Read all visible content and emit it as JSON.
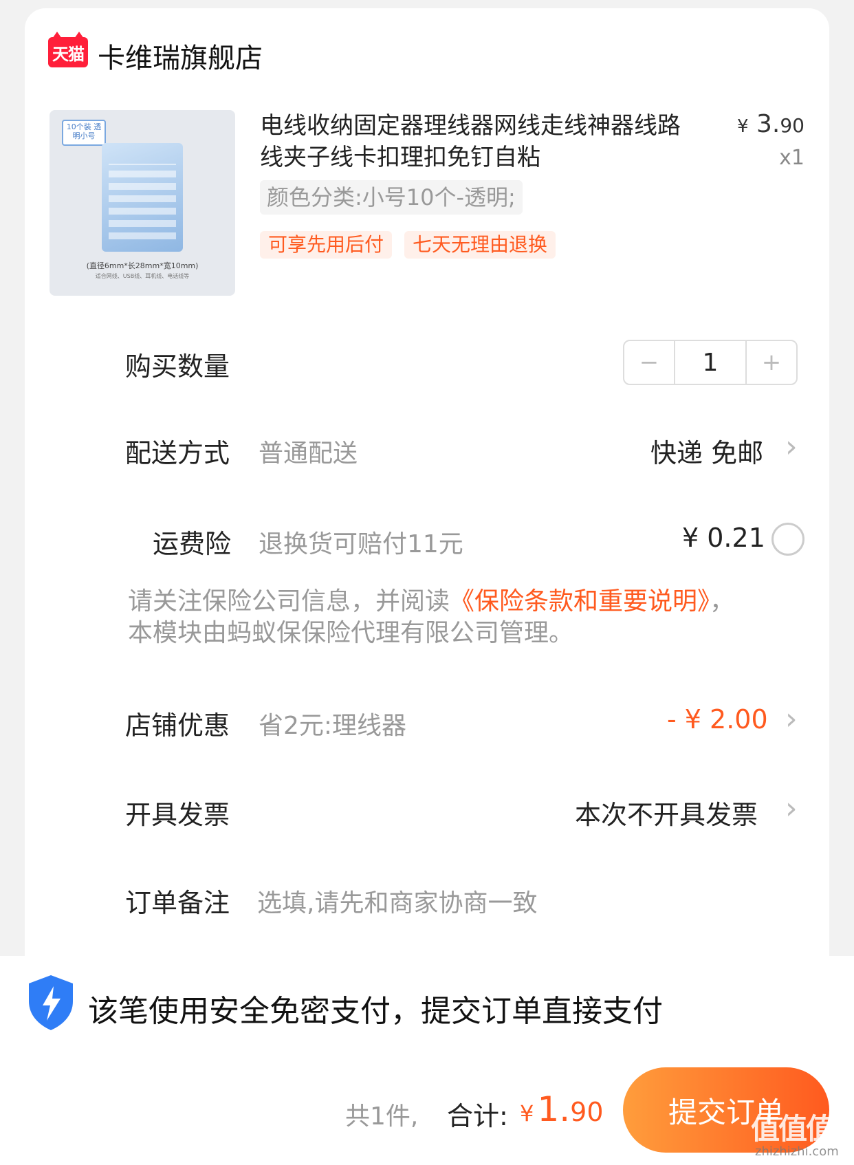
{
  "shop": {
    "logo_text": "天猫",
    "name": "卡维瑞旗舰店"
  },
  "product": {
    "title": "电线收纳固定器理线器网线走线神器线路线夹子线卡扣理扣免钉自粘",
    "price_currency": "¥",
    "price_int": "3.",
    "price_dec": "90",
    "quantity_label": "x1",
    "sku": "颜色分类:小号10个-透明;",
    "badges": [
      "可享先用后付",
      "七天无理由退换"
    ],
    "image": {
      "tag": "10个装 透明小号",
      "caption": "(直径6mm*长28mm*宽10mm)",
      "subcaption": "适合网线、USB线、耳机线、电话线等"
    }
  },
  "quantity": {
    "label": "购买数量",
    "value": "1",
    "minus": "−",
    "plus": "+"
  },
  "delivery": {
    "label": "配送方式",
    "method": "普通配送",
    "value": "快递 免邮"
  },
  "insurance": {
    "label": "运费险",
    "desc": "退换货可赔付11元",
    "price": "¥ 0.21",
    "notice_before": "请关注保险公司信息，并阅读",
    "notice_link": "《保险条款和重要说明》",
    "notice_after": "，本模块由蚂蚁保保险代理有限公司管理。"
  },
  "discount": {
    "label": "店铺优惠",
    "desc": "省2元:理线器",
    "value": "- ¥ 2.00"
  },
  "invoice": {
    "label": "开具发票",
    "value": "本次不开具发票"
  },
  "remark": {
    "label": "订单备注",
    "placeholder": "选填,请先和商家协商一致"
  },
  "security": {
    "text": "该笔使用安全免密支付，提交订单直接支付"
  },
  "summary": {
    "count": "共1件,",
    "total_label": "合计:",
    "currency": "¥",
    "total_int": "1.",
    "total_dec": "90",
    "submit": "提交订单"
  },
  "watermark": {
    "text": "值值值",
    "url": "zhizhizhi.com"
  },
  "colors": {
    "accent": "#ff5a1f",
    "shield": "#2f7df6",
    "tmall": "#ff1f3a"
  },
  "icons": [
    "tmall-logo-icon",
    "minus-icon",
    "plus-icon",
    "chevron-right-icon",
    "radio-icon",
    "shield-lightning-icon"
  ]
}
